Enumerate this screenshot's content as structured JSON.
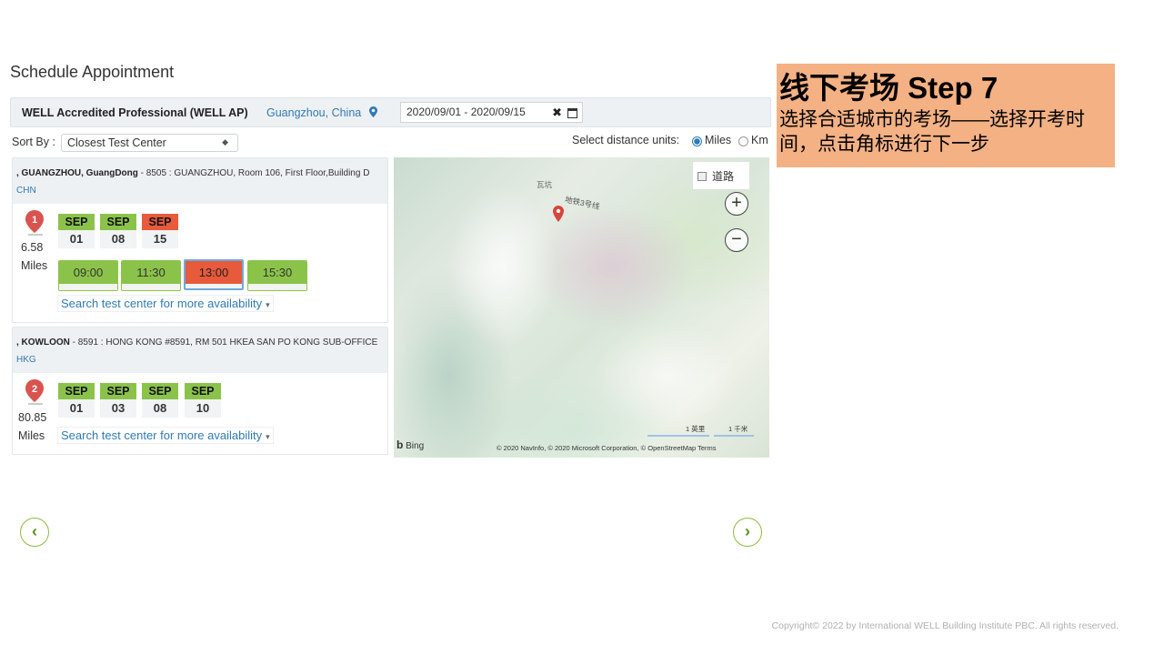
{
  "page": {
    "title": "Schedule Appointment"
  },
  "filter": {
    "exam": "WELL Accredited Professional (WELL AP)",
    "location": "Guangzhou, China",
    "date_range": "2020/09/01 - 2020/09/15",
    "clear_glyph": "✖"
  },
  "sort": {
    "label": "Sort By :",
    "selected": "Closest Test Center",
    "caret": "◆"
  },
  "units": {
    "label": "Select distance units:",
    "options": [
      "Miles",
      "Km"
    ],
    "selected": "Miles"
  },
  "centers": [
    {
      "city": ", GUANGZHOU, GuangDong",
      "address": " - 8505 : GUANGZHOU, Room 106, First Floor,Building D ",
      "country": "CHN",
      "marker": "1",
      "distance": "6.58",
      "distance_unit": "Miles",
      "dates": [
        {
          "month": "SEP",
          "day": "01"
        },
        {
          "month": "SEP",
          "day": "08"
        },
        {
          "month": "SEP",
          "day": "15",
          "selected": true
        }
      ],
      "times": [
        "09:00",
        "11:30",
        "13:00",
        "15:30"
      ],
      "selected_time": "13:00",
      "more": "Search test center for more availability"
    },
    {
      "city": ", KOWLOON",
      "address": " - 8591 : HONG KONG #8591, RM 501 HKEA SAN PO KONG SUB-OFFICE ",
      "country": "HKG",
      "marker": "2",
      "distance": "80.85",
      "distance_unit": "Miles",
      "dates": [
        {
          "month": "SEP",
          "day": "01"
        },
        {
          "month": "SEP",
          "day": "03"
        },
        {
          "month": "SEP",
          "day": "08"
        },
        {
          "month": "SEP",
          "day": "10"
        }
      ],
      "more": "Search test center for more availability"
    }
  ],
  "map": {
    "area_label": "瓦坑",
    "metro_label": "地铁3号线",
    "road_toggle": "道路",
    "zoom_in": "+",
    "zoom_out": "−",
    "brand": "Bing",
    "scale_miles": "1 英里",
    "scale_km": "1 千米",
    "copyright": "© 2020 NavInfo, © 2020 Microsoft Corporation, © OpenStreetMap Terms"
  },
  "nav": {
    "prev": "‹",
    "next": "›"
  },
  "callout": {
    "title": "线下考场 Step 7",
    "body": "选择合适城市的考场——选择开考时间，点击角标进行下一步"
  },
  "footer": {
    "copyright": "Copyright© 2022 by International WELL Building Institute PBC. All rights reserved."
  },
  "colors": {
    "accent_green": "#8bc34a",
    "selected_red": "#e75a3b",
    "link_blue": "#2f7ab8",
    "callout_bg": "#f4b183"
  }
}
